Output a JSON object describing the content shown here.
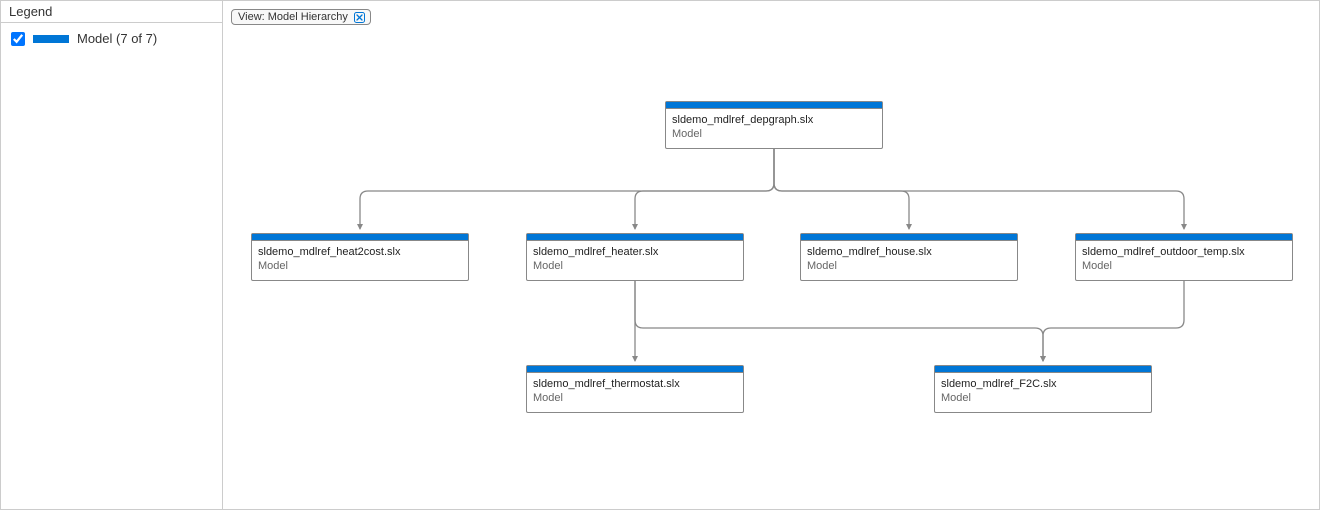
{
  "legend": {
    "title": "Legend",
    "item_label": "Model (7 of 7)"
  },
  "view_chip": {
    "label": "View: Model Hierarchy"
  },
  "nodes": {
    "root": {
      "title": "sldemo_mdlref_depgraph.slx",
      "type": "Model"
    },
    "heat2cost": {
      "title": "sldemo_mdlref_heat2cost.slx",
      "type": "Model"
    },
    "heater": {
      "title": "sldemo_mdlref_heater.slx",
      "type": "Model"
    },
    "house": {
      "title": "sldemo_mdlref_house.slx",
      "type": "Model"
    },
    "outdoor": {
      "title": "sldemo_mdlref_outdoor_temp.slx",
      "type": "Model"
    },
    "thermostat": {
      "title": "sldemo_mdlref_thermostat.slx",
      "type": "Model"
    },
    "f2c": {
      "title": "sldemo_mdlref_F2C.slx",
      "type": "Model"
    }
  },
  "graph": {
    "edges": [
      {
        "from": "root",
        "to": "heat2cost"
      },
      {
        "from": "root",
        "to": "heater"
      },
      {
        "from": "root",
        "to": "house"
      },
      {
        "from": "root",
        "to": "outdoor"
      },
      {
        "from": "heater",
        "to": "thermostat"
      },
      {
        "from": "heater",
        "to": "f2c"
      },
      {
        "from": "outdoor",
        "to": "f2c"
      }
    ]
  },
  "colors": {
    "accent": "#0076d6"
  }
}
